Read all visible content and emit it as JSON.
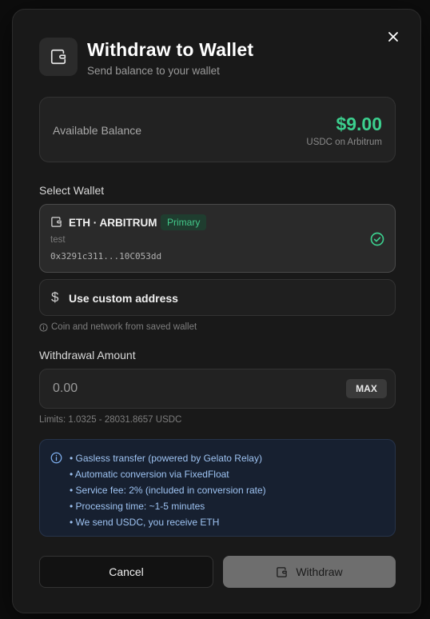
{
  "modal": {
    "title": "Withdraw to Wallet",
    "subtitle": "Send balance to your wallet",
    "close_icon": "close-icon",
    "header_icon": "wallet-icon"
  },
  "balance": {
    "label": "Available Balance",
    "amount": "$9.00",
    "network": "USDC on Arbitrum",
    "amount_color": "#3ccf8e"
  },
  "select_wallet": {
    "label": "Select Wallet",
    "selected_wallet": {
      "name": "ETH · ARBITRUM",
      "badge": "Primary",
      "label": "test",
      "address": "0x3291c311...10C053dd",
      "selected": true
    },
    "custom_address": {
      "label": "Use custom address",
      "icon": "dollar-icon"
    },
    "hint": "Coin and network from saved wallet"
  },
  "withdrawal_amount": {
    "label": "Withdrawal Amount",
    "placeholder": "0.00",
    "value": "",
    "max_label": "MAX",
    "limits": "Limits: 1.0325 - 28031.8657 USDC"
  },
  "info": {
    "items": [
      "• Gasless transfer (powered by Gelato Relay)",
      "• Automatic conversion via FixedFloat",
      "• Service fee: 2% (included in conversion rate)",
      "• Processing time: ~1-5 minutes",
      "• We send USDC, you receive ETH"
    ]
  },
  "actions": {
    "cancel_label": "Cancel",
    "withdraw_label": "Withdraw"
  },
  "colors": {
    "accent_green": "#3ccf8e",
    "info_blue": "#9ec3f2",
    "badge_bg": "#1f3d2f"
  }
}
